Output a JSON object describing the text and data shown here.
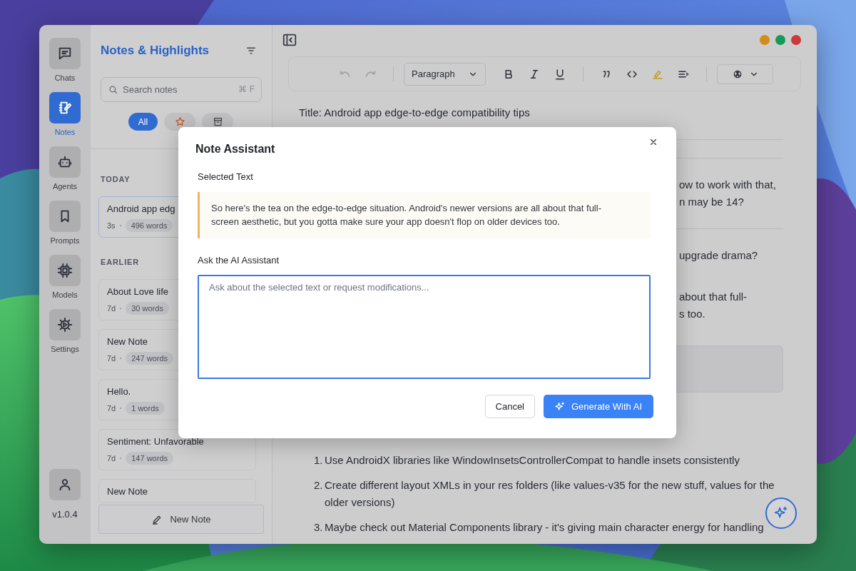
{
  "rail": {
    "items": [
      {
        "label": "Chats",
        "selected": false
      },
      {
        "label": "Notes",
        "selected": true
      },
      {
        "label": "Agents",
        "selected": false
      },
      {
        "label": "Prompts",
        "selected": false
      },
      {
        "label": "Models",
        "selected": false
      },
      {
        "label": "Settings",
        "selected": false
      }
    ],
    "version": "v1.0.4"
  },
  "notes_panel": {
    "title": "Notes & Highlights",
    "search": {
      "placeholder": "Search notes",
      "shortcut": "⌘ F"
    },
    "filters": [
      {
        "label": "All",
        "selected": true
      },
      {
        "selected": false
      },
      {
        "selected": false
      }
    ],
    "groups": [
      {
        "heading": "TODAY",
        "notes": [
          {
            "title": "Android app edg",
            "age": "3s",
            "words": "496 words",
            "selected": true
          }
        ]
      },
      {
        "heading": "EARLIER",
        "notes": [
          {
            "title": "About Love life",
            "age": "7d",
            "words": "30 words",
            "selected": false
          },
          {
            "title": "New Note",
            "age": "7d",
            "words": "247 words",
            "selected": false
          },
          {
            "title": "Hello.",
            "age": "7d",
            "words": "1 words",
            "selected": false
          },
          {
            "title": "Sentiment: Unfavorable",
            "age": "7d",
            "words": "147 words",
            "selected": false
          },
          {
            "title": "New Note",
            "selected": false
          }
        ]
      }
    ],
    "new_note_button": "New Note"
  },
  "editor": {
    "toolbar": {
      "block_style": "Paragraph"
    },
    "blocks": [
      {
        "kind": "paragraph",
        "text": "Title: Android app edge-to-edge compatibility tips"
      },
      {
        "kind": "rule"
      },
      {
        "kind": "rule"
      },
      {
        "kind": "fragment",
        "lines": [
          "ow to work with that,",
          "n may be 14?"
        ]
      },
      {
        "kind": "rule"
      },
      {
        "kind": "fragment",
        "lines": [
          "upgrade drama?"
        ]
      },
      {
        "kind": "fragment",
        "lines": [
          "about that full-",
          "s too."
        ]
      },
      {
        "kind": "block"
      },
      {
        "kind": "list",
        "items": [
          {
            "marker": "1.",
            "text": "Use AndroidX libraries like WindowInsetsControllerCompat to handle insets consistently"
          },
          {
            "marker": "2.",
            "text": "Create different layout XMLs in your res folders (like values-v35 for the new stuff, values for the older versions)"
          },
          {
            "marker": "3.",
            "text": "Maybe check out Material Components library - it's giving main character energy for handling"
          }
        ]
      }
    ]
  },
  "dialog": {
    "title": "Note Assistant",
    "selected_label": "Selected Text",
    "selected_text": "So here's the tea on the edge-to-edge situation. Android's newer versions are all about that full-screen aesthetic, but you gotta make sure your app doesn't flop on older devices too.",
    "ask_label": "Ask the AI Assistant",
    "placeholder": "Ask about the selected text or request modifications...",
    "buttons": [
      {
        "label": "Cancel",
        "kind": "secondary"
      },
      {
        "label": "Generate With AI",
        "kind": "primary"
      }
    ]
  }
}
